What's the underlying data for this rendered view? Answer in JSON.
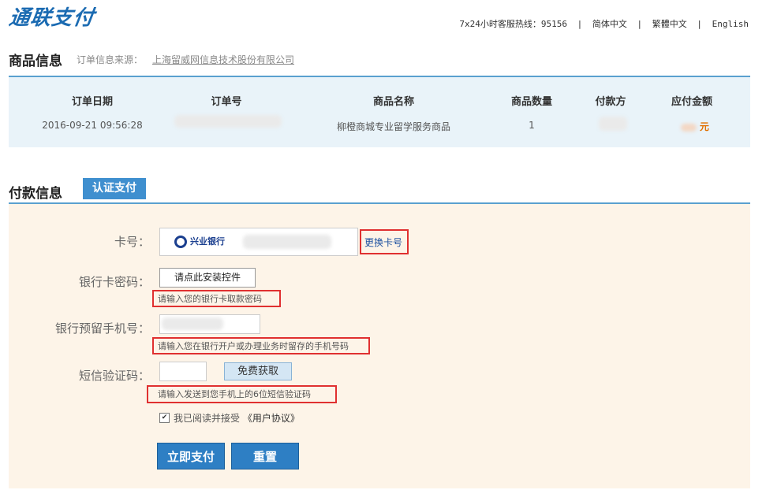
{
  "header": {
    "logo_text": "通联支付",
    "hotline": "7x24小时客服热线：95156",
    "lang_simplified": "简体中文",
    "lang_traditional": "繁體中文",
    "lang_english": "English"
  },
  "product": {
    "section_title": "商品信息",
    "source_label": "订单信息来源：",
    "source_value": "上海留威网信息技术股份有限公司",
    "columns": [
      "订单日期",
      "订单号",
      "商品名称",
      "商品数量",
      "付款方",
      "应付金额"
    ],
    "order_date": "2016-09-21 09:56:28",
    "product_name": "柳橙商城专业留学服务商品",
    "quantity": "1",
    "amount_unit": "元"
  },
  "payment": {
    "section_title": "付款信息",
    "tab_label": "认证支付",
    "card_label": "卡号：",
    "bank_name": "兴业银行",
    "change_card": "更换卡号",
    "password_label": "银行卡密码：",
    "install_button": "请点此安装控件",
    "password_hint": "请输入您的银行卡取款密码",
    "phone_label": "银行预留手机号：",
    "phone_hint": "请输入您在银行开户或办理业务时留存的手机号码",
    "sms_label": "短信验证码：",
    "sms_button": "免费获取",
    "sms_hint": "请输入发送到您手机上的6位短信验证码",
    "agree_text": "我已阅读并接受",
    "agreement_link": "《用户协议》",
    "pay_button": "立即支付",
    "reset_button": "重置"
  },
  "colors": {
    "accent": "#2e7fc4",
    "highlight_box": "#e03030",
    "product_bg": "#e9f3f9",
    "payment_bg": "#fdf4e8"
  }
}
